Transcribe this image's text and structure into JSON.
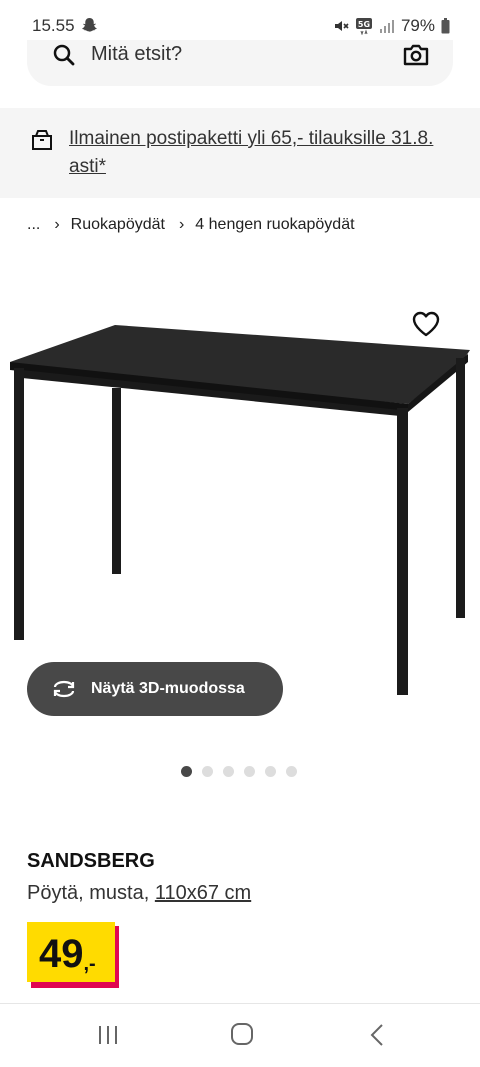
{
  "status_bar": {
    "time": "15.55",
    "battery": "79%"
  },
  "search": {
    "placeholder": "Mitä etsit?"
  },
  "promo": {
    "text": "Ilmainen postipaketti yli 65,- tilauksille 31.8. asti*"
  },
  "breadcrumb": {
    "items": [
      "...",
      "Ruokapöydät",
      "4 hengen ruokapöydät"
    ]
  },
  "gallery": {
    "view_3d_label": "Näytä 3D-muodossa",
    "dots_total": 6,
    "active_index": 0
  },
  "product": {
    "name": "SANDSBERG",
    "description": "Pöytä, musta,",
    "size": "110x67 cm",
    "price_int": "49",
    "price_dec": ",-"
  },
  "colors": {
    "price_yellow": "#ffdb00",
    "price_red": "#e00751",
    "button_dark": "#484848",
    "promo_bg": "#f5f5f5"
  },
  "icons": [
    "snapchat-icon",
    "mute-icon",
    "network-5g-icon",
    "signal-icon",
    "battery-icon",
    "search-icon",
    "camera-icon",
    "box-icon",
    "heart-icon",
    "rotate-3d-icon",
    "recents-icon",
    "home-icon",
    "back-icon"
  ]
}
